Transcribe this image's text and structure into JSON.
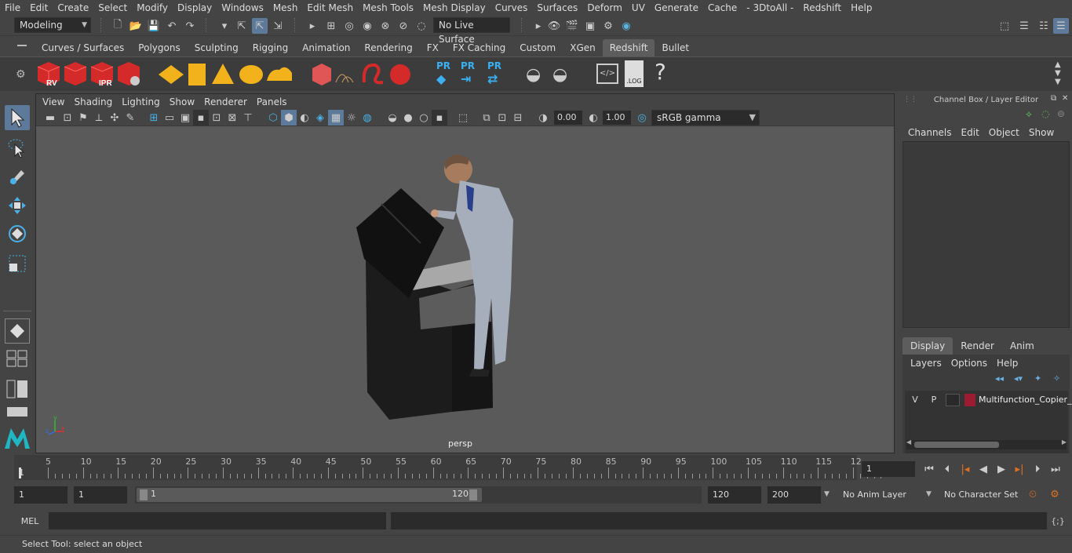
{
  "menubar": {
    "items": [
      "File",
      "Edit",
      "Create",
      "Select",
      "Modify",
      "Display",
      "Windows",
      "Mesh",
      "Edit Mesh",
      "Mesh Tools",
      "Mesh Display",
      "Curves",
      "Surfaces",
      "Deform",
      "UV",
      "Generate",
      "Cache",
      "- 3DtoAll -",
      "Redshift",
      "Help"
    ]
  },
  "statusline": {
    "workspace": "Modeling",
    "live_surface": "No Live Surface"
  },
  "shelf": {
    "tabs": [
      "Curves / Surfaces",
      "Polygons",
      "Sculpting",
      "Rigging",
      "Animation",
      "Rendering",
      "FX",
      "FX Caching",
      "Custom",
      "XGen",
      "Redshift",
      "Bullet"
    ],
    "active_tab": "Redshift",
    "icon_labels": {
      "rv": "RV",
      "ipr": "IPR",
      "pr": "PR",
      "log": ".LOG",
      "help": "?"
    }
  },
  "viewport": {
    "menu": [
      "View",
      "Shading",
      "Lighting",
      "Show",
      "Renderer",
      "Panels"
    ],
    "exposure": "0.00",
    "gamma": "1.00",
    "colorspace": "sRGB gamma",
    "camera_label": "persp",
    "axis_labels": {
      "x": "x",
      "y": "y",
      "z": "z"
    }
  },
  "channelbox": {
    "title": "Channel Box / Layer Editor",
    "menu": [
      "Channels",
      "Edit",
      "Object",
      "Show"
    ],
    "layer_tabs": [
      "Display",
      "Render",
      "Anim"
    ],
    "layer_menu": [
      "Layers",
      "Options",
      "Help"
    ],
    "layer": {
      "v": "V",
      "p": "P",
      "color": "#9b1b30",
      "name": "Multifunction_Copier_"
    }
  },
  "timeline": {
    "ticks": [
      "5",
      "10",
      "15",
      "20",
      "25",
      "30",
      "35",
      "40",
      "45",
      "50",
      "55",
      "60",
      "65",
      "70",
      "75",
      "80",
      "85",
      "90",
      "95",
      "100",
      "105",
      "110",
      "115",
      "12"
    ],
    "start_label": "1",
    "current_frame": "1"
  },
  "range": {
    "start": "1",
    "playback_start": "1",
    "slider_start": "1",
    "slider_end": "120",
    "playback_end": "120",
    "end": "200",
    "anim_layer": "No Anim Layer",
    "char_set": "No Character Set"
  },
  "mel": {
    "label": "MEL"
  },
  "helpline": {
    "text": "Select Tool: select an object"
  }
}
